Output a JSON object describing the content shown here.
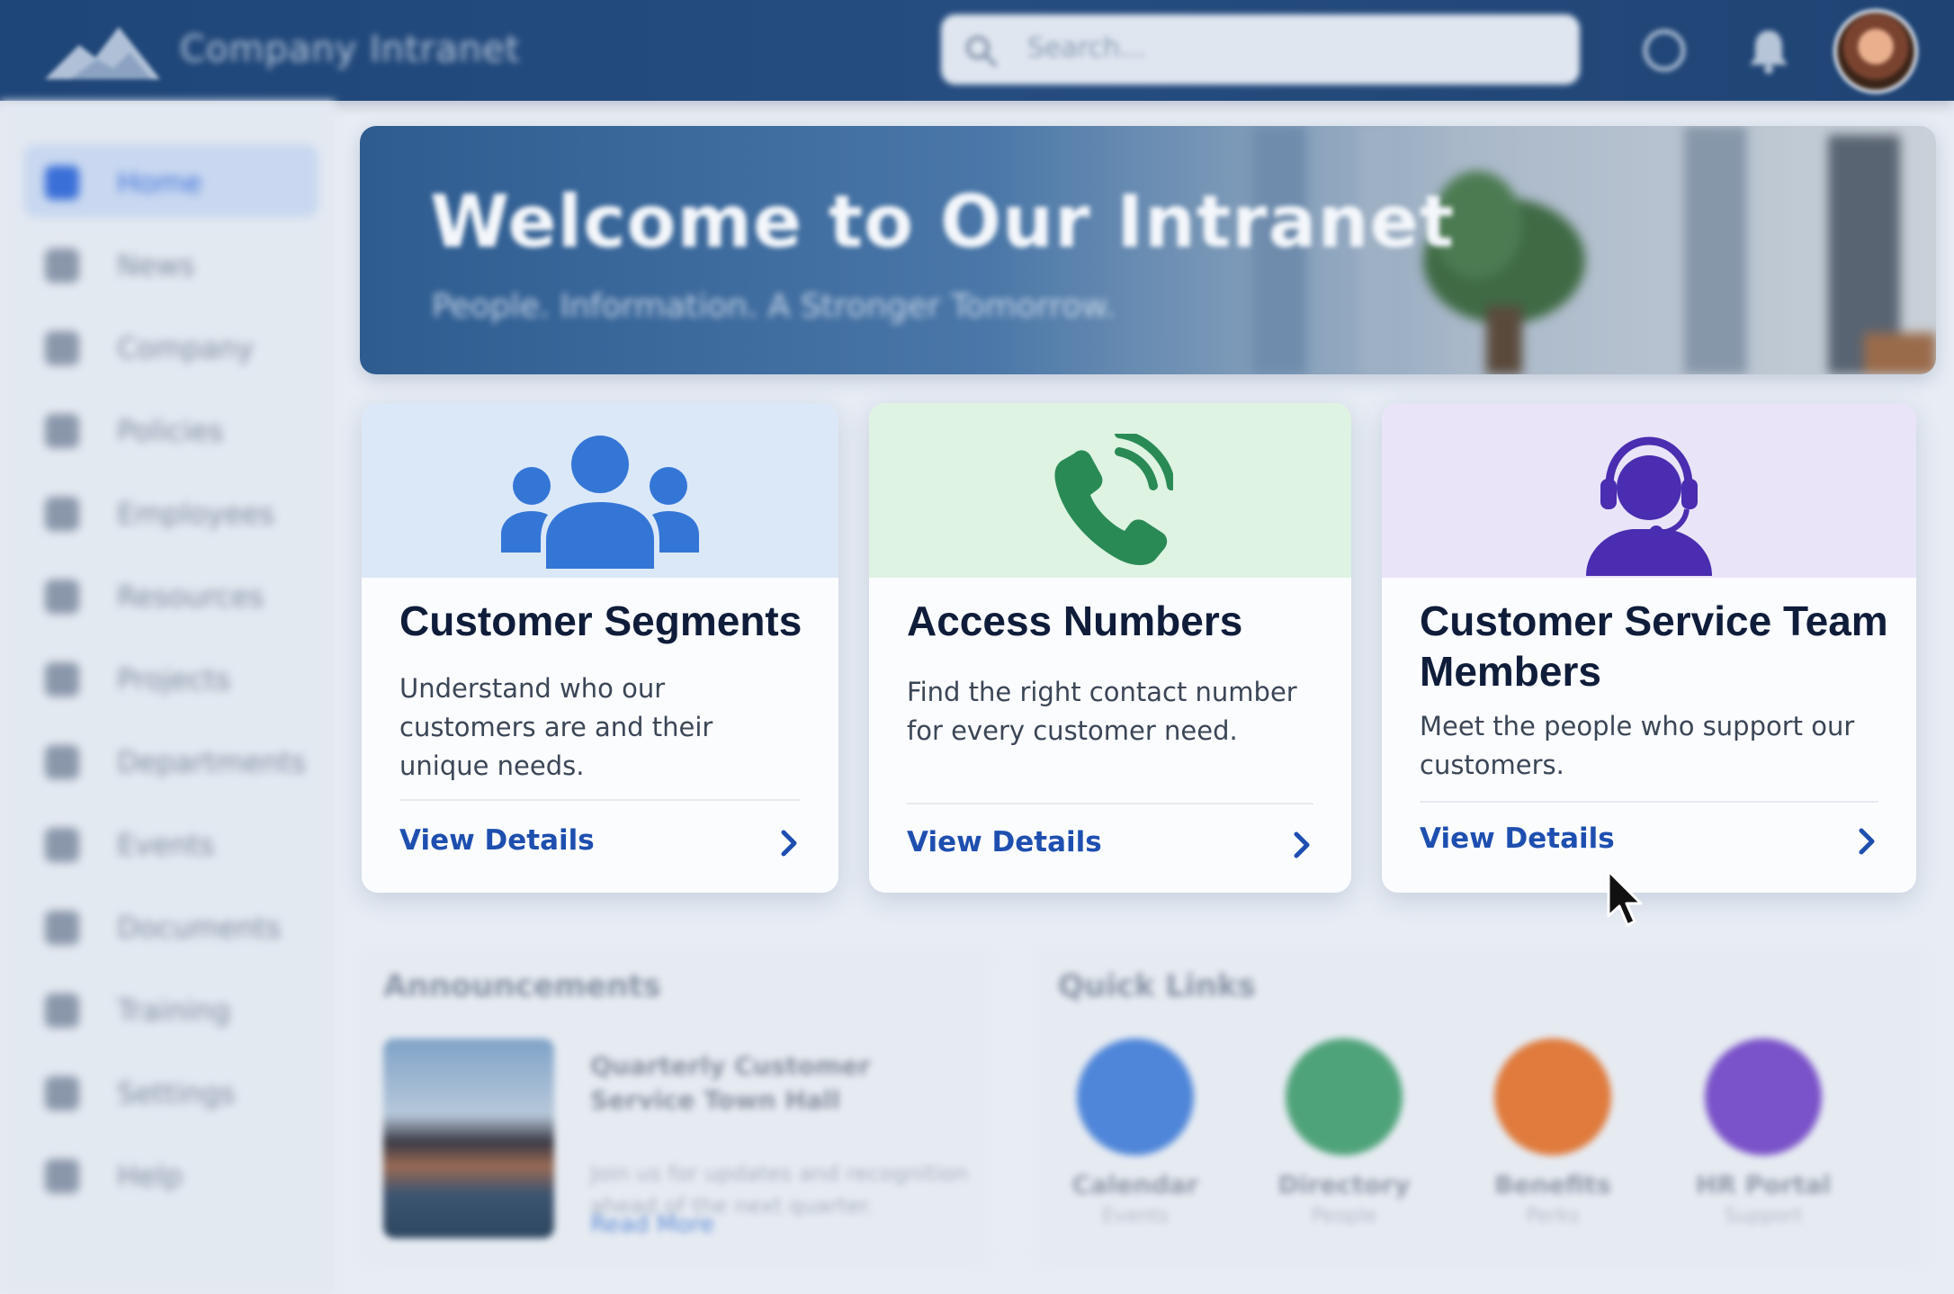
{
  "header": {
    "app_title": "Company Intranet",
    "search_placeholder": "Search..."
  },
  "sidebar": {
    "items": [
      {
        "label": "Home",
        "active": true
      },
      {
        "label": "News"
      },
      {
        "label": "Company"
      },
      {
        "label": "Policies"
      },
      {
        "label": "Employees"
      },
      {
        "label": "Resources"
      },
      {
        "label": "Projects"
      },
      {
        "label": "Departments"
      },
      {
        "label": "Events"
      },
      {
        "label": "Documents"
      },
      {
        "label": "Training"
      },
      {
        "label": "Settings"
      },
      {
        "label": "Help"
      }
    ]
  },
  "hero": {
    "title": "Welcome to Our Intranet",
    "subtitle": "People. Information. A Stronger Tomorrow."
  },
  "cards": [
    {
      "title": "Customer Segments",
      "description": "Understand who our customers are and their unique needs.",
      "link": "View Details",
      "icon": "customer-segments-icon",
      "band_color": "#dbe8f8",
      "icon_color": "#3476d6"
    },
    {
      "title": "Access Numbers",
      "description": "Find the right contact number for every customer need.",
      "link": "View Details",
      "icon": "phone-icon",
      "band_color": "#def3e2",
      "icon_color": "#2a8a55"
    },
    {
      "title": "Customer Service Team Members",
      "description": "Meet the people who support our customers.",
      "link": "View Details",
      "icon": "headset-agent-icon",
      "band_color": "#e9e4f8",
      "icon_color": "#4a2db0"
    }
  ],
  "announcements": {
    "title": "Announcements",
    "headline": "Quarterly Customer Service Town Hall",
    "text": "Join us for updates and recognition ahead of the next quarter.",
    "link": "Read More"
  },
  "quick_links": {
    "title": "Quick Links",
    "items": [
      {
        "label": "Calendar",
        "sub": "Events",
        "color": "#4f86d9",
        "icon": "calendar-icon"
      },
      {
        "label": "Directory",
        "sub": "People",
        "color": "#4fa37a",
        "icon": "directory-icon"
      },
      {
        "label": "Benefits",
        "sub": "Perks",
        "color": "#e07b3d",
        "icon": "benefits-icon"
      },
      {
        "label": "HR Portal",
        "sub": "Support",
        "color": "#7a52c9",
        "icon": "hr-portal-icon"
      }
    ]
  }
}
